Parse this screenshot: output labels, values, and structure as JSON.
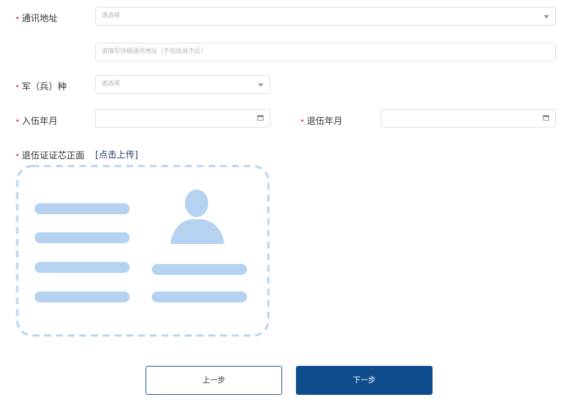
{
  "required_mark": "•",
  "address": {
    "label": "通讯地址",
    "select_placeholder": "请选择",
    "detail_placeholder": "请填写详细通讯地址（不包括省市区）"
  },
  "service_type": {
    "label": "军（兵）种",
    "placeholder": "请选择"
  },
  "enlist_date": {
    "label": "入伍年月"
  },
  "retire_date": {
    "label": "退伍年月"
  },
  "certificate": {
    "label": "退伍证证芯正面",
    "upload_link": "[点击上传]"
  },
  "buttons": {
    "prev": "上一步",
    "next": "下一步"
  },
  "colors": {
    "required": "#e4393c",
    "primary": "#0f4c8c",
    "placeholder_art": "#b5d3f0",
    "link": "#1e3c72"
  },
  "icons": {
    "select": "caret-down",
    "date": "calendar"
  }
}
